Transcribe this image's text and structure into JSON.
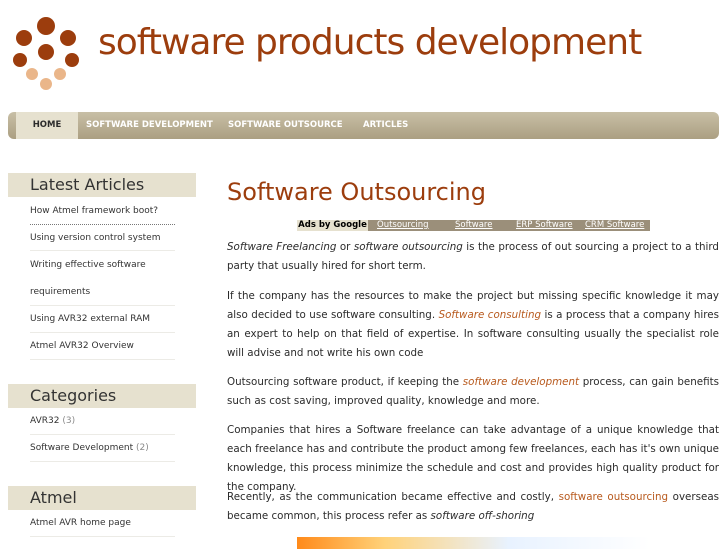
{
  "site": {
    "title": "software products development",
    "colors": {
      "brand": "#9c3d0d",
      "nav": "#ab9f82",
      "panel": "#e6e1cf"
    }
  },
  "nav": {
    "items": [
      {
        "label": "HOME",
        "active": true
      },
      {
        "label": "SOFTWARE DEVELOPMENT"
      },
      {
        "label": "SOFTWARE OUTSOURCE"
      },
      {
        "label": "ARTICLES"
      }
    ]
  },
  "sidebar": {
    "latest": {
      "heading": "Latest Articles",
      "items": [
        "How Atmel framework boot?",
        "Using version control system",
        "Writing effective software",
        "requirements",
        "Using AVR32 external RAM",
        "Atmel AVR32 Overview"
      ]
    },
    "categories": {
      "heading": "Categories",
      "items": [
        {
          "label": "AVR32",
          "count": "(3)"
        },
        {
          "label": "Software Development",
          "count": "(2)"
        }
      ]
    },
    "atmel": {
      "heading": "Atmel",
      "items": [
        "Atmel AVR home page"
      ]
    }
  },
  "main": {
    "title": "Software Outsourcing",
    "ads": {
      "label": "Ads by Google",
      "links": [
        "Outsourcing",
        "Software",
        "ERP Software",
        "CRM Software"
      ]
    },
    "p1": {
      "a": "Software Freelancing",
      "b": " or ",
      "c": "software outsourcing",
      "d": " is the process of out sourcing a project to a third party that usually hired for short term."
    },
    "p2": {
      "a": "If the company has the resources to make the project but missing specific knowledge it may also decided to use software consulting. ",
      "b": "Software consulting",
      "c": " is a process that a company hires an expert to help on that field of expertise. In software consulting usually the specialist role will advise and not write his own code"
    },
    "p3": {
      "a": "Outsourcing software product, if keeping the ",
      "b": "software development",
      "c": " process, can gain benefits such as cost saving, improved quality, knowledge and more."
    },
    "p4": {
      "a": "Companies that hires a Software freelance can take advantage of a unique knowledge that each freelance has and contribute the product among few freelances, each has it's own unique knowledge, this process minimize the schedule and cost and provides high quality product for the company."
    },
    "p5": {
      "a": "Recently, as the communication became effective and costly, ",
      "b": "software outsourcing",
      "c": " overseas became common, this process refer as ",
      "d": "software off-shoring"
    }
  }
}
